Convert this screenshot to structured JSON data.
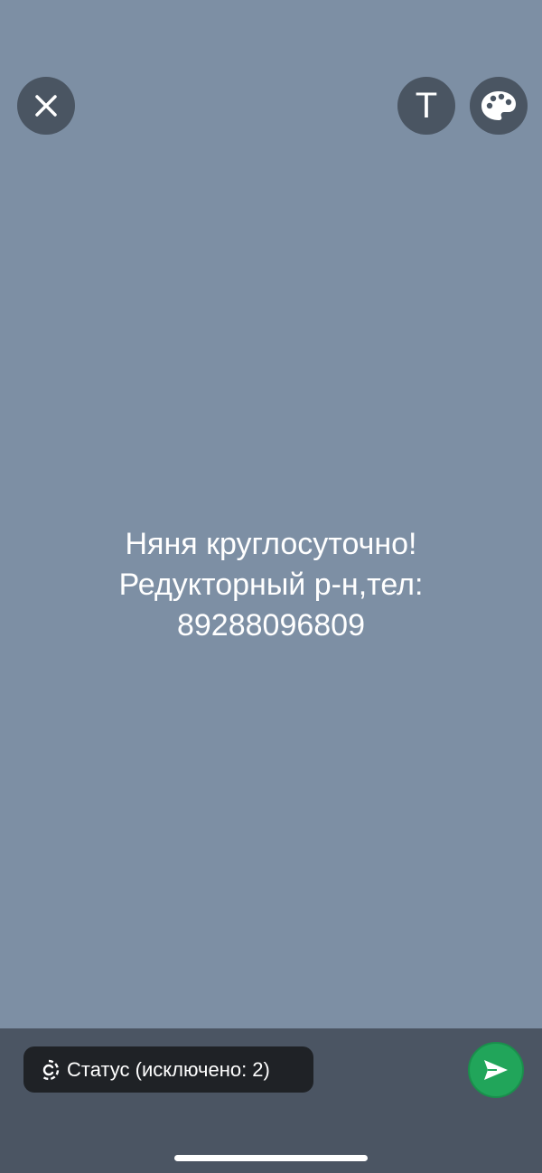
{
  "toolbar": {
    "close_icon": "close-icon",
    "text_tool_label": "T",
    "text_tool_icon": "text-icon",
    "color_icon": "palette-icon"
  },
  "status": {
    "lines": [
      "Няня круглосуточно!",
      "Редукторный р-н,тел:",
      "89288096809"
    ],
    "background_color": "#7d8fa4",
    "text_color": "#ffffff"
  },
  "footer": {
    "privacy_label": "Статус (исключено: 2)",
    "privacy_icon": "status-icon",
    "send_icon": "send-icon",
    "send_color": "#21a55a"
  }
}
